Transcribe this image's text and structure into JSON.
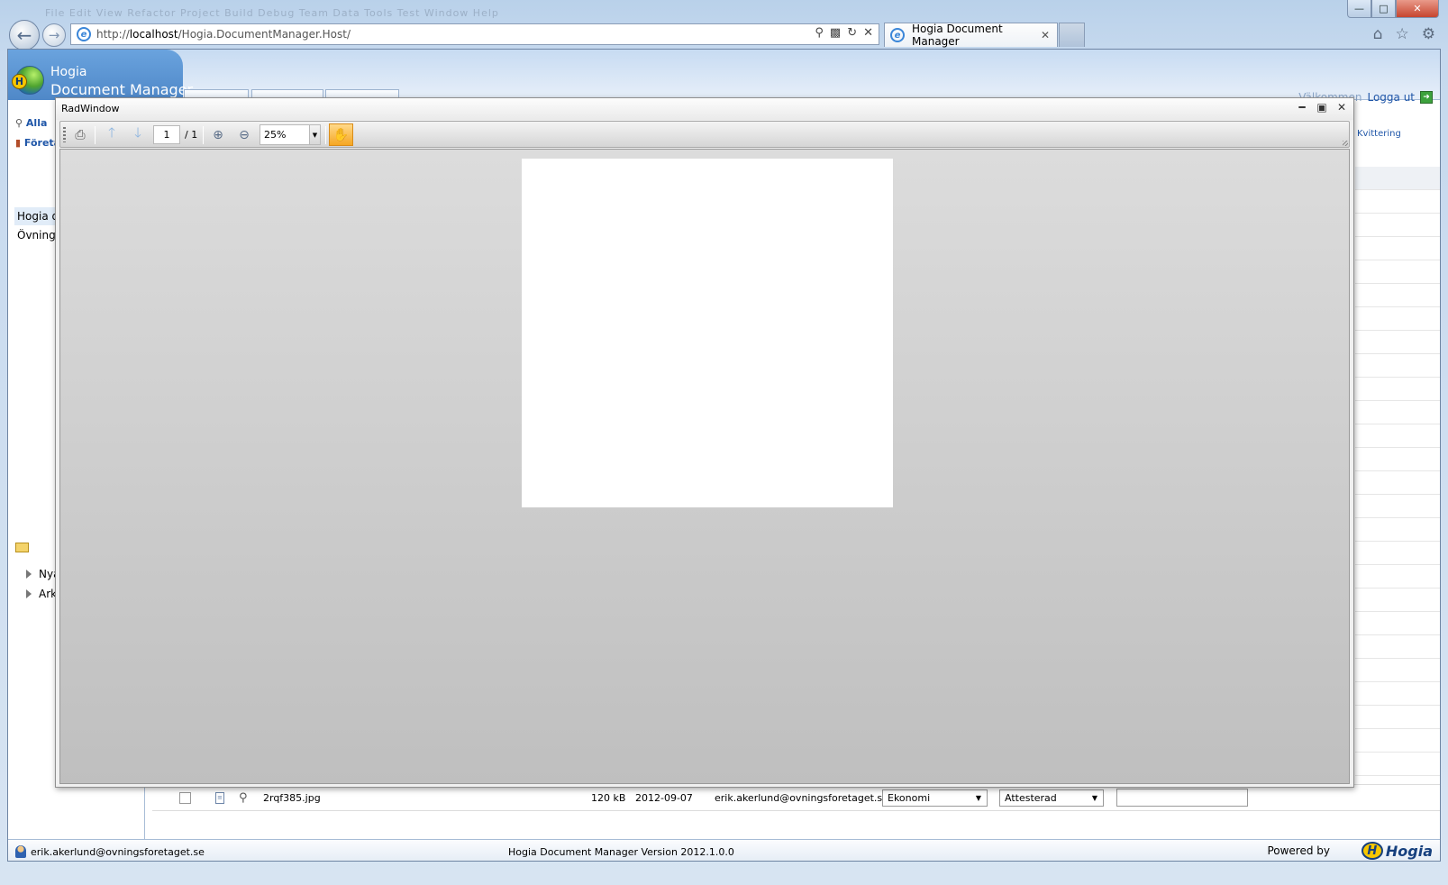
{
  "browser": {
    "url_prefix": "http://",
    "url_host": "localhost",
    "url_path": "/Hogia.DocumentManager.Host/",
    "tab_title": "Hogia Document Manager",
    "menu_ghost": "File  Edit  View  Refactor  Project  Build  Debug  Team  Data  Tools  Test  Window  Help"
  },
  "app": {
    "brand_line1": "Hogia",
    "brand_line2": "Document Manager",
    "logout_label": "Logga ut",
    "user_label": "Välkommen",
    "right_link": "Kvittering"
  },
  "sidebar": {
    "all_link": "Alla",
    "company_link": "Företag",
    "items": [
      {
        "label": "Hogia demo"
      },
      {
        "label": "Övningsföretaget"
      }
    ],
    "tree": [
      {
        "label": "Nya"
      },
      {
        "label": "Arkiv"
      }
    ]
  },
  "grid_row": {
    "filename": "2rqf385.jpg",
    "size": "120 kB",
    "date": "2012-09-07",
    "user": "erik.akerlund@ovningsforetaget.se",
    "category": "Ekonomi",
    "status": "Attesterad",
    "comment": ""
  },
  "footer": {
    "user_email": "erik.akerlund@ovningsforetaget.se",
    "version": "Hogia Document Manager Version 2012.1.0.0",
    "powered_by": "Powered by",
    "logo_text": "Hogia"
  },
  "radwindow": {
    "title": "RadWindow",
    "page_current": "1",
    "page_total": "/ 1",
    "zoom": "25%"
  },
  "icons": {
    "print": "printer-icon",
    "prev_page": "arrow-up-icon",
    "next_page": "arrow-down-icon",
    "zoom_in": "zoom-in-icon",
    "zoom_out": "zoom-out-icon",
    "pan": "hand-icon"
  },
  "colors": {
    "accent_link": "#1f56a8",
    "pan_active": "#f5a623",
    "header_blue": "#4f88c8"
  }
}
